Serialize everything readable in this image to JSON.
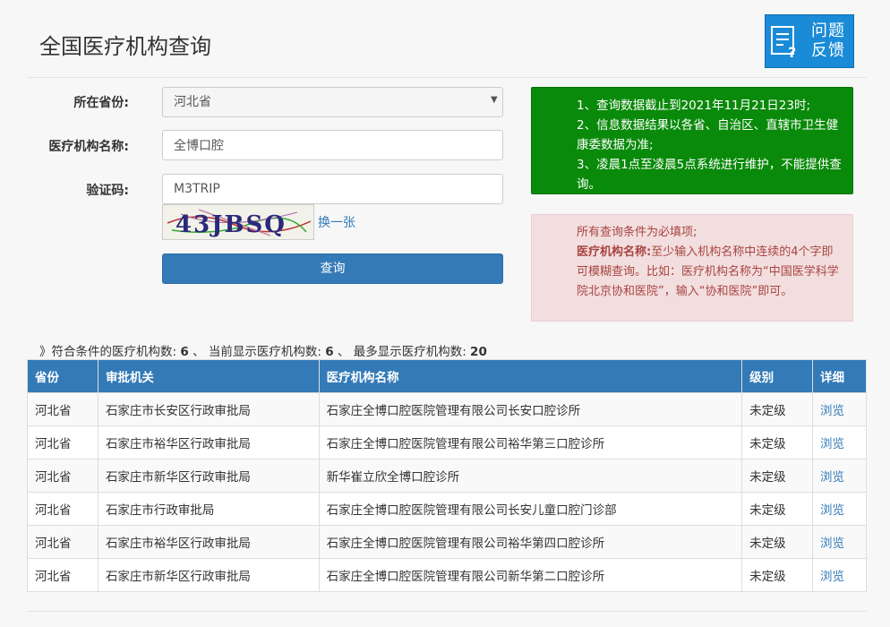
{
  "page": {
    "title": "全国医疗机构查询"
  },
  "feedback": {
    "label_line1": "问题",
    "label_line2": "反馈",
    "icon": "feedback-icon"
  },
  "form": {
    "province": {
      "label": "所在省份:",
      "value": "河北省"
    },
    "institution": {
      "label": "医疗机构名称:",
      "value": "全博口腔"
    },
    "captcha": {
      "label": "验证码:",
      "value": "M3TRIP",
      "refresh_label": "换一张",
      "image_text": "43JBSQ"
    },
    "query_label": "查询"
  },
  "notices": {
    "info": [
      "1、查询数据截止到2021年11月21日23时;",
      "2、信息数据结果以各省、自治区、直辖市卫生健康委数据为准;",
      "3、凌晨1点至凌晨5点系统进行维护，不能提供查询。"
    ],
    "rules": {
      "line1": "所有查询条件为必填项;",
      "bold_label": "医疗机构名称:",
      "line2": "至少输入机构名称中连续的4个字即可模糊查询。比如：医疗机构名称为“中国医学科学院北京协和医院”，输入“协和医院”即可。"
    }
  },
  "summary": {
    "prefix": "》符合条件的医疗机构数:",
    "match_count": "6",
    "sep1": "、 当前显示医疗机构数:",
    "shown_count": "6",
    "sep2": "、 最多显示医疗机构数:",
    "max_count": "20"
  },
  "table": {
    "headers": [
      "省份",
      "审批机关",
      "医疗机构名称",
      "级别",
      "详细"
    ],
    "rows": [
      {
        "province": "河北省",
        "authority": "石家庄市长安区行政审批局",
        "name": "石家庄全博口腔医院管理有限公司长安口腔诊所",
        "level": "未定级",
        "detail": "浏览"
      },
      {
        "province": "河北省",
        "authority": "石家庄市裕华区行政审批局",
        "name": "石家庄全博口腔医院管理有限公司裕华第三口腔诊所",
        "level": "未定级",
        "detail": "浏览"
      },
      {
        "province": "河北省",
        "authority": "石家庄市新华区行政审批局",
        "name": "新华崔立欣全博口腔诊所",
        "level": "未定级",
        "detail": "浏览"
      },
      {
        "province": "河北省",
        "authority": "石家庄市行政审批局",
        "name": "石家庄全博口腔医院管理有限公司长安儿童口腔门诊部",
        "level": "未定级",
        "detail": "浏览"
      },
      {
        "province": "河北省",
        "authority": "石家庄市裕华区行政审批局",
        "name": "石家庄全博口腔医院管理有限公司裕华第四口腔诊所",
        "level": "未定级",
        "detail": "浏览"
      },
      {
        "province": "河北省",
        "authority": "石家庄市新华区行政审批局",
        "name": "石家庄全博口腔医院管理有限公司新华第二口腔诊所",
        "level": "未定级",
        "detail": "浏览"
      }
    ]
  },
  "colors": {
    "primary": "#337ab7",
    "notice_green": "#0a8a0a",
    "notice_red_bg": "#f2dede",
    "notice_red_text": "#a94442",
    "feedback_bg": "#1a8bd6"
  }
}
